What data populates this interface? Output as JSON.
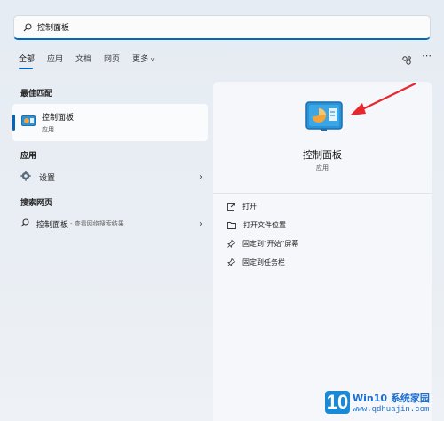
{
  "search": {
    "value": "控制面板"
  },
  "tabs": [
    {
      "label": "全部"
    },
    {
      "label": "应用"
    },
    {
      "label": "文档"
    },
    {
      "label": "网页"
    },
    {
      "label": "更多"
    }
  ],
  "sections": {
    "best_match": "最佳匹配",
    "apps": "应用",
    "web": "搜索网页"
  },
  "best_match": {
    "title": "控制面板",
    "subtitle": "应用"
  },
  "apps": [
    {
      "label": "设置"
    }
  ],
  "web_result": {
    "label": "控制面板",
    "hint": "- 查看网络搜索结果"
  },
  "detail": {
    "title": "控制面板",
    "subtitle": "应用",
    "actions": [
      {
        "label": "打开",
        "icon": "open-icon"
      },
      {
        "label": "打开文件位置",
        "icon": "folder-icon"
      },
      {
        "label": "固定到\"开始\"屏幕",
        "icon": "pin-icon"
      },
      {
        "label": "固定到任务栏",
        "icon": "pin-icon"
      }
    ]
  },
  "watermark": {
    "number": "10",
    "line1": "Win10 系统家园",
    "line2": "www.qdhuajin.com"
  },
  "colors": {
    "accent": "#0067c0",
    "arrow": "#e8262e"
  }
}
